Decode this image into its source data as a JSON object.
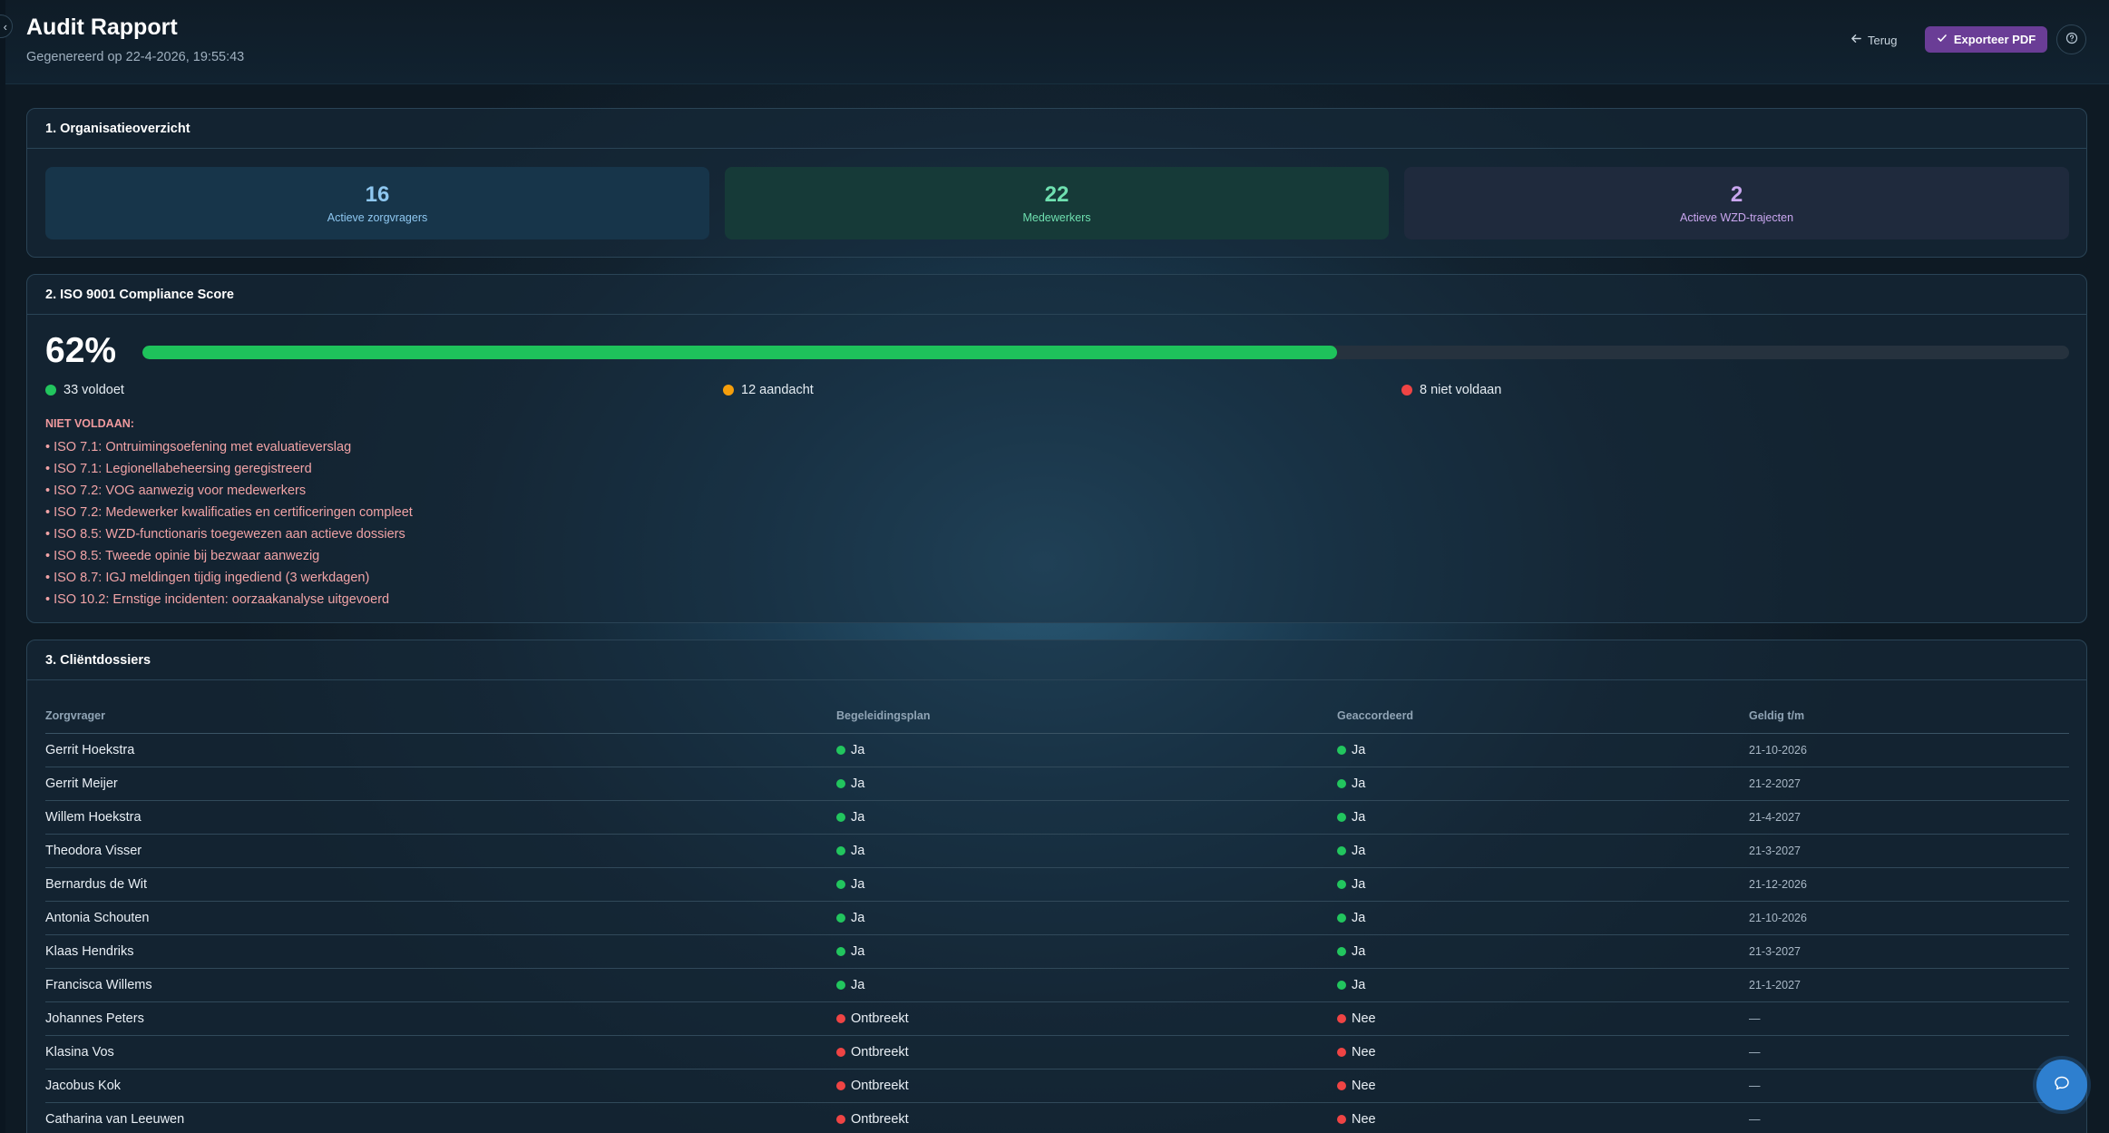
{
  "header": {
    "title": "Audit Rapport",
    "subtitle": "Gegenereerd op 22-4-2026, 19:55:43",
    "back_label": "Terug",
    "export_label": "Exporteer PDF",
    "back_icon": "arrow-left-icon",
    "export_icon": "check-icon",
    "help_icon": "help-icon"
  },
  "org": {
    "title": "1. Organisatieoverzicht",
    "stats": [
      {
        "value": "16",
        "label": "Actieve zorgvragers"
      },
      {
        "value": "22",
        "label": "Medewerkers"
      },
      {
        "value": "2",
        "label": "Actieve WZD-trajecten"
      }
    ]
  },
  "iso": {
    "title": "2. ISO 9001 Compliance Score",
    "score_label": "62%",
    "score_fraction": 0.62,
    "legend": [
      {
        "label": "33 voldoet",
        "color": "#22c55e"
      },
      {
        "label": "12 aandacht",
        "color": "#f59e0b"
      },
      {
        "label": "8 niet voldaan",
        "color": "#ef4444"
      }
    ],
    "fail_title": "NIET VOLDAAN:",
    "fail_items": [
      "• ISO 7.1: Ontruimingsoefening met evaluatieverslag",
      "• ISO 7.1: Legionellabeheersing geregistreerd",
      "• ISO 7.2: VOG aanwezig voor medewerkers",
      "• ISO 7.2: Medewerker kwalificaties en certificeringen compleet",
      "• ISO 8.5: WZD-functionaris toegewezen aan actieve dossiers",
      "• ISO 8.5: Tweede opinie bij bezwaar aanwezig",
      "• ISO 8.7: IGJ meldingen tijdig ingediend (3 werkdagen)",
      "• ISO 10.2: Ernstige incidenten: oorzaakanalyse uitgevoerd"
    ]
  },
  "clients": {
    "title": "3. Cliëntdossiers",
    "columns": [
      "Zorgvrager",
      "Begeleidingsplan",
      "Geaccordeerd",
      "Geldig t/m"
    ],
    "rows": [
      {
        "name": "Gerrit Hoekstra",
        "plan": "Ja",
        "approved": "Ja",
        "valid": "21-10-2026",
        "ok": true
      },
      {
        "name": "Gerrit Meijer",
        "plan": "Ja",
        "approved": "Ja",
        "valid": "21-2-2027",
        "ok": true
      },
      {
        "name": "Willem Hoekstra",
        "plan": "Ja",
        "approved": "Ja",
        "valid": "21-4-2027",
        "ok": true
      },
      {
        "name": "Theodora Visser",
        "plan": "Ja",
        "approved": "Ja",
        "valid": "21-3-2027",
        "ok": true
      },
      {
        "name": "Bernardus de Wit",
        "plan": "Ja",
        "approved": "Ja",
        "valid": "21-12-2026",
        "ok": true
      },
      {
        "name": "Antonia Schouten",
        "plan": "Ja",
        "approved": "Ja",
        "valid": "21-10-2026",
        "ok": true
      },
      {
        "name": "Klaas Hendriks",
        "plan": "Ja",
        "approved": "Ja",
        "valid": "21-3-2027",
        "ok": true
      },
      {
        "name": "Francisca Willems",
        "plan": "Ja",
        "approved": "Ja",
        "valid": "21-1-2027",
        "ok": true
      },
      {
        "name": "Johannes Peters",
        "plan": "Ontbreekt",
        "approved": "Nee",
        "valid": "—",
        "ok": false
      },
      {
        "name": "Klasina Vos",
        "plan": "Ontbreekt",
        "approved": "Nee",
        "valid": "—",
        "ok": false
      },
      {
        "name": "Jacobus Kok",
        "plan": "Ontbreekt",
        "approved": "Nee",
        "valid": "—",
        "ok": false
      },
      {
        "name": "Catharina van Leeuwen",
        "plan": "Ontbreekt",
        "approved": "Nee",
        "valid": "—",
        "ok": false
      }
    ]
  },
  "colors": {
    "ok": "#22c55e",
    "bad": "#ef4444",
    "accent": "#6a3d96"
  },
  "chat_icon": "chat-bubble-icon"
}
